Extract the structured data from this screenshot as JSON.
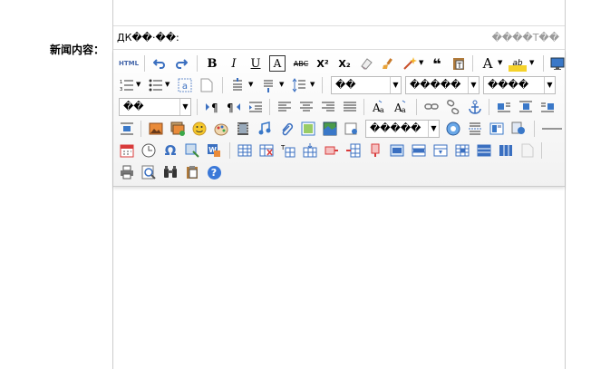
{
  "form": {
    "content_label": "新闻内容："
  },
  "editor": {
    "path_text": "ДК��·��:",
    "word_count_text": "����Т��"
  },
  "toolbar": {
    "html_label": "HTML",
    "bold_label": "B",
    "italic_label": "I",
    "underline_label": "U",
    "fontborder_label": "A",
    "strike_label": "ABC",
    "superscript_label": "X²",
    "subscript_label": "X₂",
    "quote_label": "❝",
    "forecolor_label": "A",
    "highlight_label": "ab",
    "heading_select": "��",
    "paragraph_select": "����",
    "fontfamily_select": "������",
    "fontsize_select": "�����",
    "customstyle_select": "��",
    "anchor_select": "�����",
    "help_label": "?",
    "special_char_label": "Ω"
  }
}
